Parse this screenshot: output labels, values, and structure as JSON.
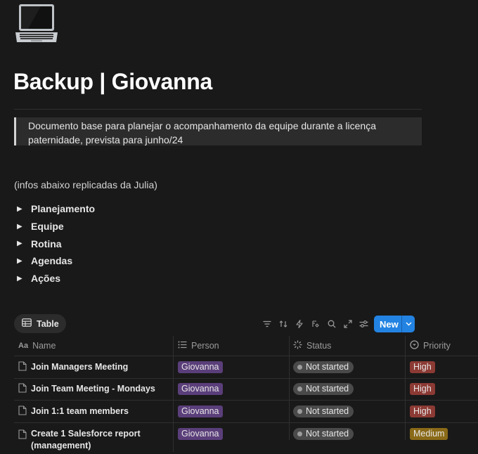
{
  "page": {
    "icon": "laptop-icon",
    "title": "Backup | Giovanna",
    "callout": "Documento base para planejar o acompanhamento da equipe durante a licença paternidade, prevista para junho/24",
    "note": "(infos abaixo replicadas da Julia)"
  },
  "toggles": [
    "Planejamento",
    "Equipe",
    "Rotina",
    "Agendas",
    "Ações"
  ],
  "database": {
    "view_tab": "Table",
    "new_button": "New",
    "toolbar_icons": [
      "filter-icon",
      "sort-icon",
      "lightning-icon",
      "ai-icon",
      "search-icon",
      "expand-icon",
      "settings-icon"
    ],
    "columns": [
      "Name",
      "Person",
      "Status",
      "Priority"
    ],
    "rows": [
      {
        "name": "Join Managers Meeting",
        "person": "Giovanna",
        "status": "Not started",
        "priority": "High"
      },
      {
        "name": "Join Team Meeting - Mondays",
        "person": "Giovanna",
        "status": "Not started",
        "priority": "High"
      },
      {
        "name": "Join 1:1 team members",
        "person": "Giovanna",
        "status": "Not started",
        "priority": "High"
      },
      {
        "name": "Create 1 Salesforce report (management)",
        "person": "Giovanna",
        "status": "Not started",
        "priority": "Medium"
      }
    ]
  },
  "colors": {
    "background": "#191919",
    "accent": "#2383e2",
    "person_tag": "#5a3e7a",
    "high_tag": "#8c3a34",
    "medium_tag": "#8a6a18"
  }
}
